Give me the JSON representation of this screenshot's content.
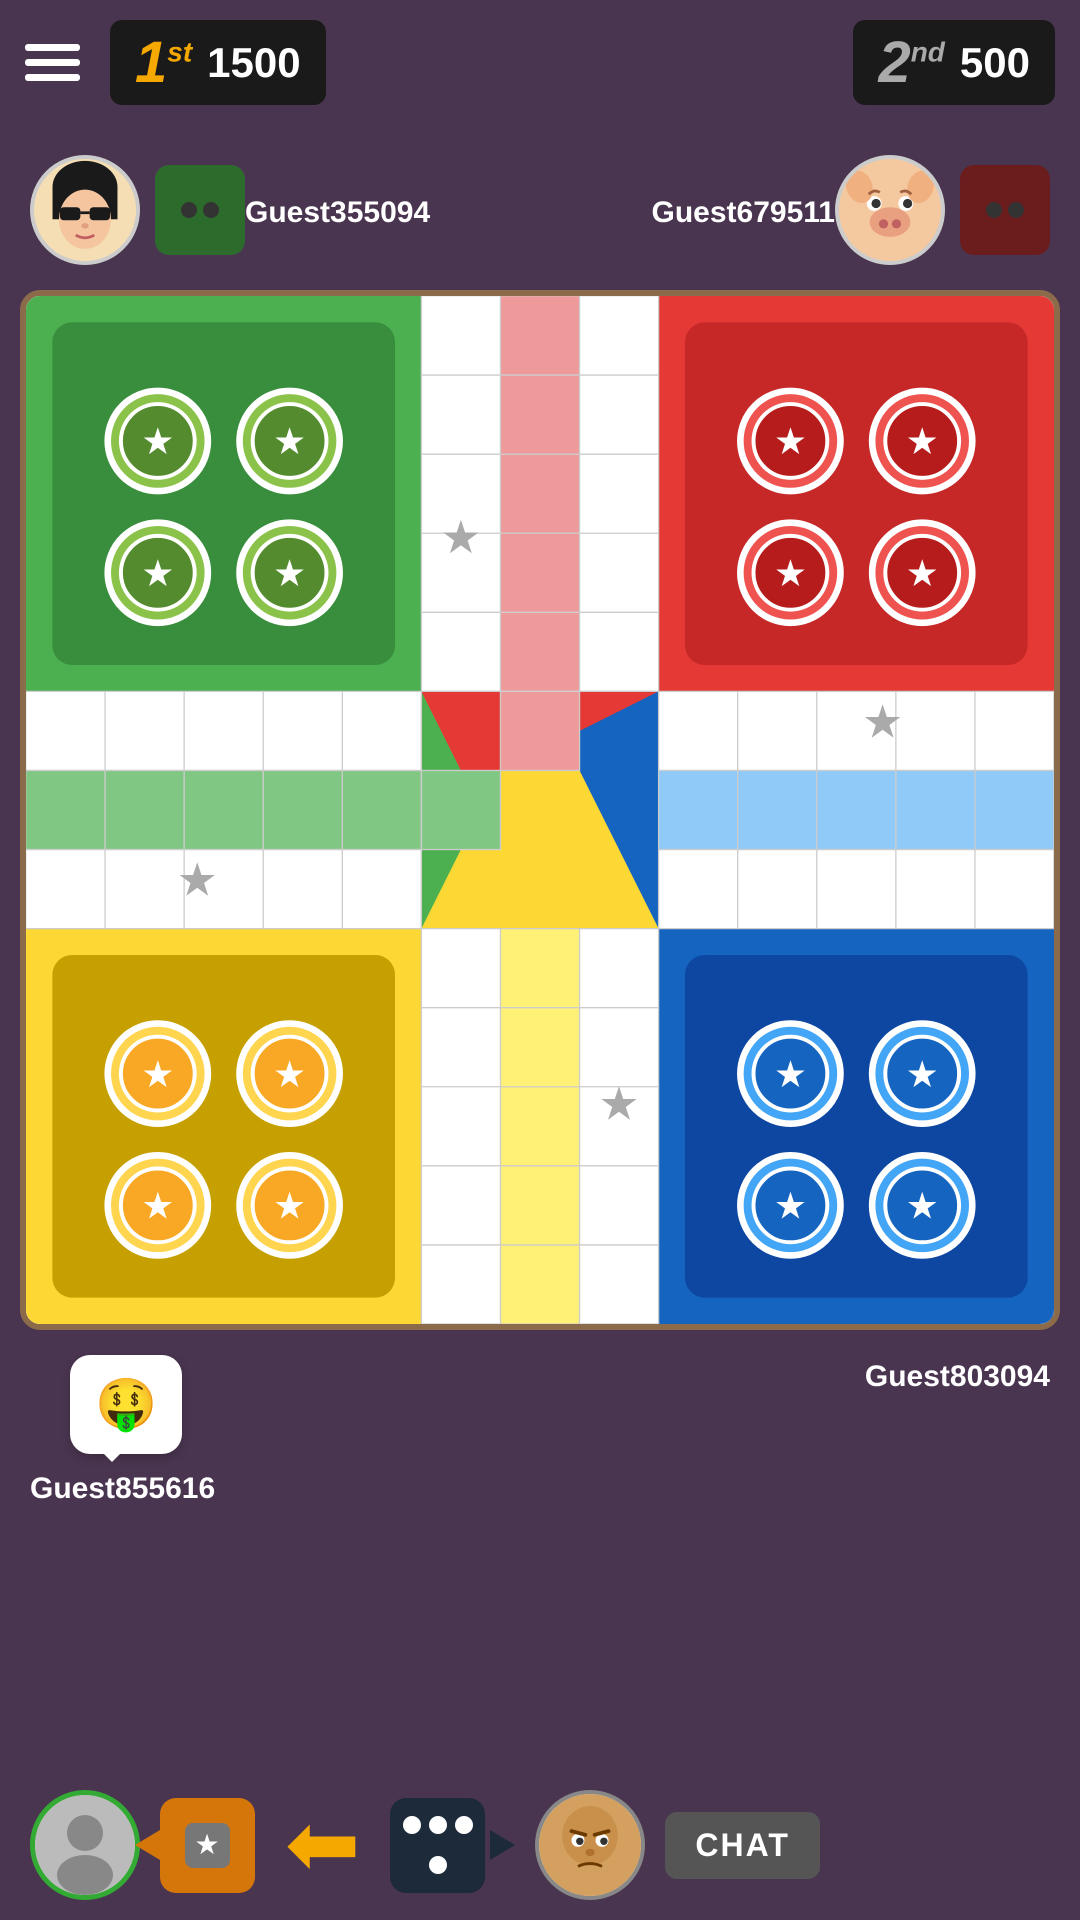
{
  "header": {
    "menu_label": "menu",
    "first_place": {
      "rank": "1",
      "rank_suffix": "st",
      "score": "1500"
    },
    "second_place": {
      "rank": "2",
      "rank_suffix": "nd",
      "score": "500"
    }
  },
  "players": {
    "top_left": {
      "name": "Guest355094",
      "avatar_type": "woman",
      "dice_face": 2,
      "color": "green"
    },
    "top_right": {
      "name": "Guest679511",
      "avatar_type": "pig",
      "dice_face": 2,
      "color": "red"
    },
    "bottom_left": {
      "name": "Guest855616",
      "avatar_type": "generic",
      "dice_face": 4,
      "color": "yellow",
      "chat_emoji": "🤑"
    },
    "bottom_right": {
      "name": "Guest803094",
      "avatar_type": "bald",
      "dice_face": 4,
      "color": "blue"
    }
  },
  "bottom_bar": {
    "chat_label": "CHAT",
    "star_icon": "★",
    "back_arrow": "←"
  },
  "board": {
    "colors": {
      "green": "#4caf50",
      "red": "#e53935",
      "yellow": "#fdd835",
      "blue": "#1565c0",
      "green_home_bg": "#388e3c",
      "red_home_bg": "#c62828",
      "yellow_home_bg": "#c6a000",
      "blue_home_bg": "#0d47a1",
      "white": "#ffffff",
      "border": "#8B6B4A"
    }
  }
}
